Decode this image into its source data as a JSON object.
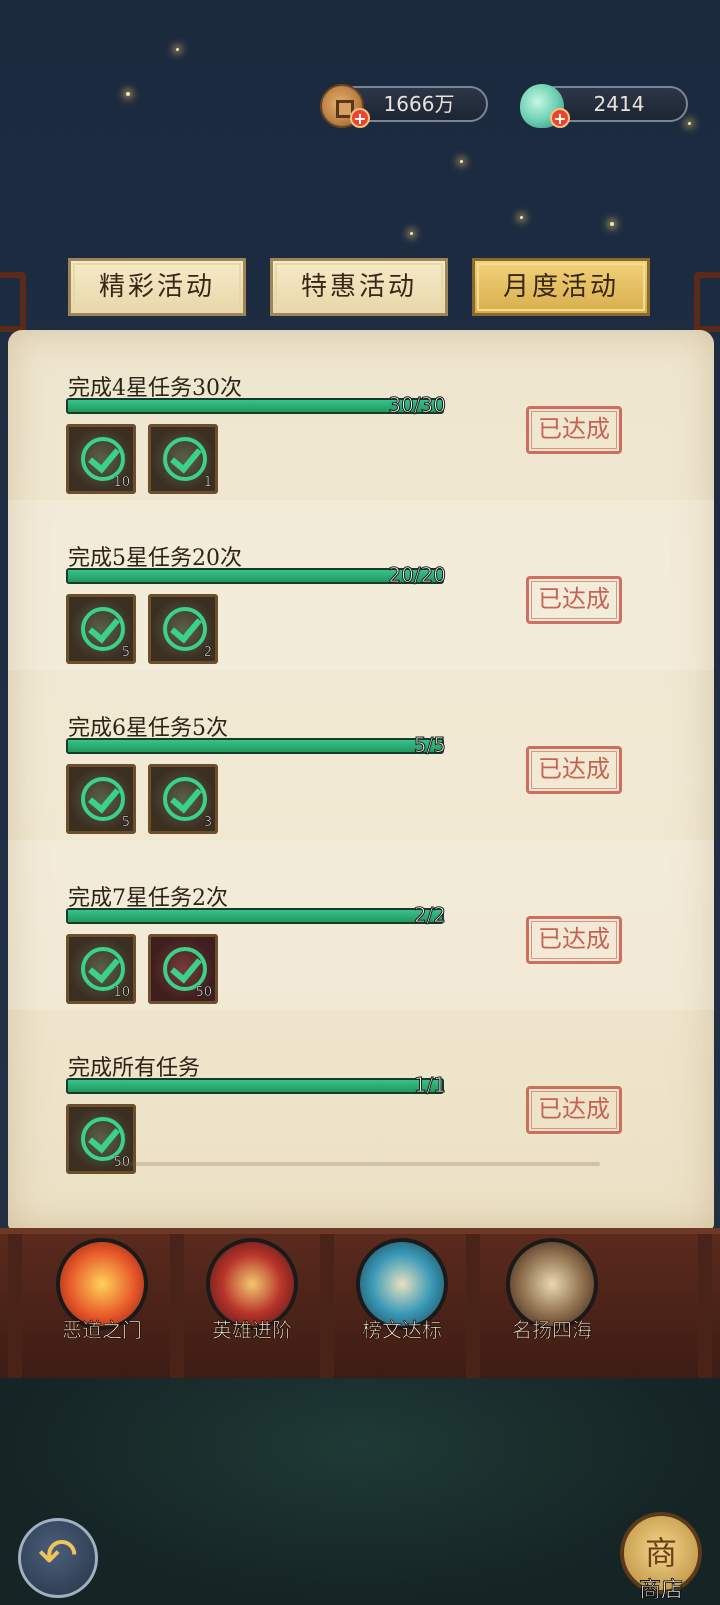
{
  "currency": {
    "coins": "1666万",
    "jade": "2414"
  },
  "tabs": [
    {
      "label": "精彩活动",
      "active": false
    },
    {
      "label": "特惠活动",
      "active": false
    },
    {
      "label": "月度活动",
      "active": true
    }
  ],
  "tasks": [
    {
      "title": "完成4星任务30次",
      "progress": "30/30",
      "progress_fraction": 1.0,
      "rewards": [
        {
          "count": "10",
          "style": "dark"
        },
        {
          "count": "1",
          "style": "dark"
        }
      ],
      "status": "已达成"
    },
    {
      "title": "完成5星任务20次",
      "progress": "20/20",
      "progress_fraction": 1.0,
      "rewards": [
        {
          "count": "5",
          "style": "dark"
        },
        {
          "count": "2",
          "style": "dark"
        }
      ],
      "status": "已达成"
    },
    {
      "title": "完成6星任务5次",
      "progress": "5/5",
      "progress_fraction": 1.0,
      "rewards": [
        {
          "count": "5",
          "style": "dark"
        },
        {
          "count": "3",
          "style": "dark"
        }
      ],
      "status": "已达成"
    },
    {
      "title": "完成7星任务2次",
      "progress": "2/2",
      "progress_fraction": 1.0,
      "rewards": [
        {
          "count": "10",
          "style": "dark"
        },
        {
          "count": "50",
          "style": "red"
        }
      ],
      "status": "已达成"
    },
    {
      "title": "完成所有任务",
      "progress": "1/1",
      "progress_fraction": 1.0,
      "rewards": [
        {
          "count": "50",
          "style": "dark"
        }
      ],
      "status": "已达成"
    }
  ],
  "bottom_nav": [
    {
      "label": "恶道之门",
      "icon": "fire-swirl-icon",
      "color": "#e8582a"
    },
    {
      "label": "英雄进阶",
      "icon": "hero-shield-icon",
      "color": "#b8342a"
    },
    {
      "label": "榜文达标",
      "icon": "notice-board-icon",
      "color": "#3a9ab8"
    },
    {
      "label": "名扬四海",
      "icon": "junk-ship-icon",
      "color": "#8a6a4a"
    }
  ],
  "shop": {
    "label": "商店",
    "glyph": "商"
  },
  "colors": {
    "progress_green": "#22985f",
    "stamp_red": "#c24b3a",
    "tab_active": "#d7ae4d",
    "panel_bg": "#efe6cf"
  }
}
